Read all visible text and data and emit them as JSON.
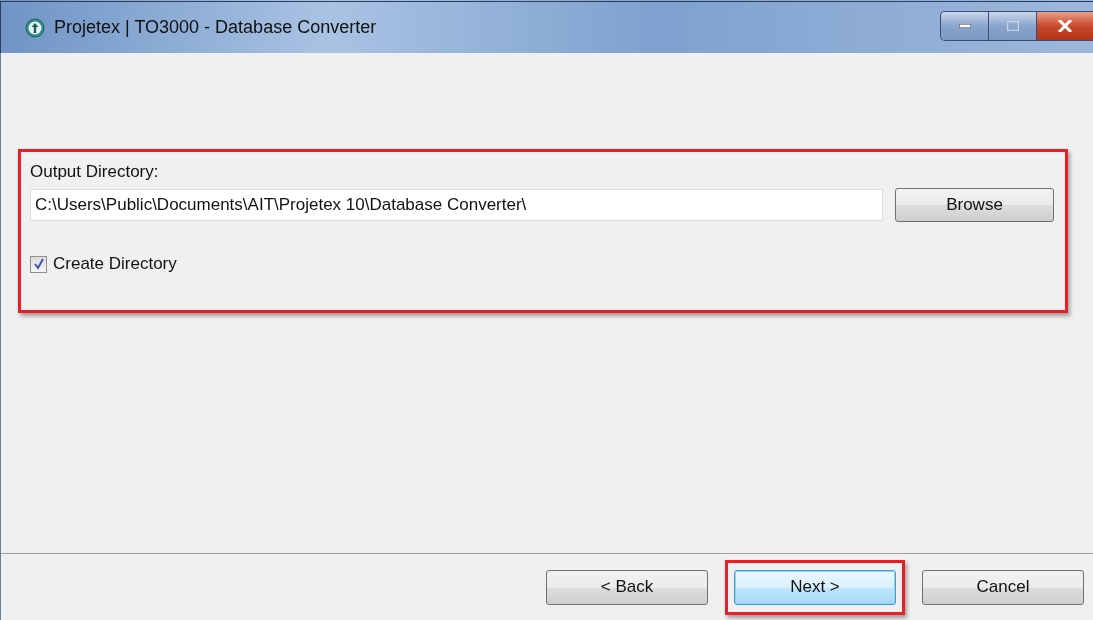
{
  "window": {
    "title": "Projetex | TO3000 - Database Converter"
  },
  "output": {
    "label": "Output Directory:",
    "value": "C:\\Users\\Public\\Documents\\AIT\\Projetex 10\\Database Converter\\",
    "browse": "Browse",
    "highlighted": true
  },
  "create_directory": {
    "label": "Create Directory",
    "checked": true
  },
  "buttons": [
    {
      "label": "< Back",
      "focused": false,
      "highlighted": false
    },
    {
      "label": "Next >",
      "focused": true,
      "highlighted": true
    },
    {
      "label": "Cancel",
      "focused": false,
      "highlighted": false
    }
  ]
}
